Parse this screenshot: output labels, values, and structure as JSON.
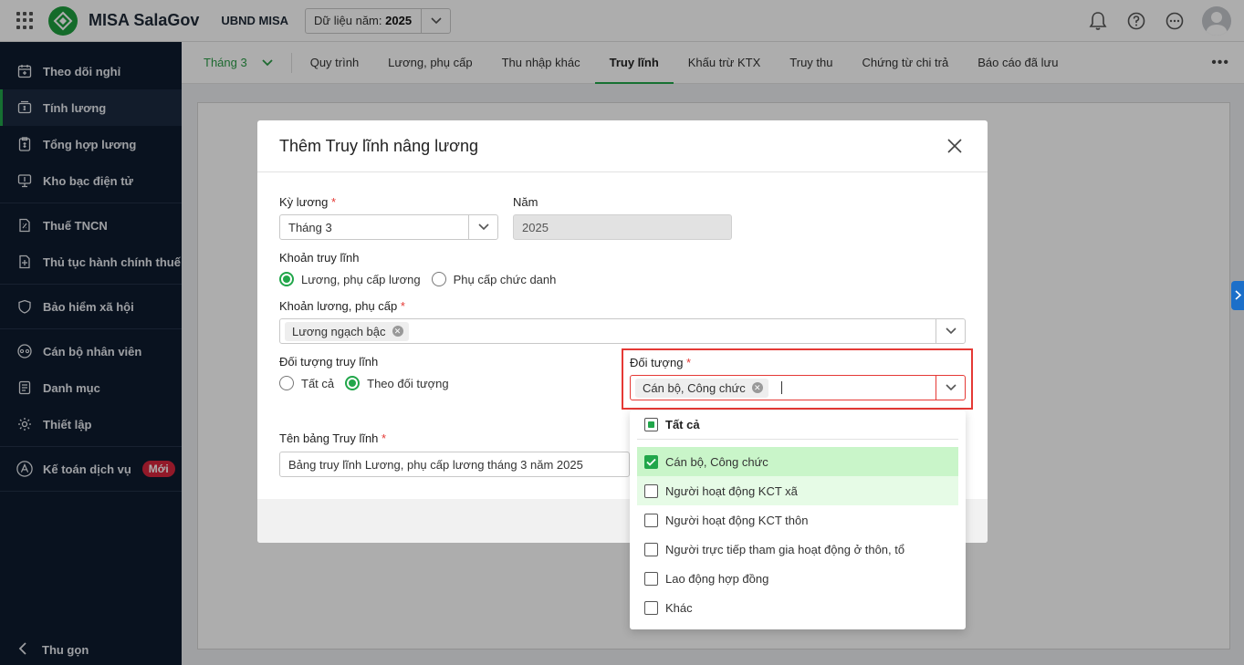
{
  "header": {
    "brand": "MISA SalaGov",
    "org": "UBND MISA",
    "year_prefix": "Dữ liệu năm:",
    "year_value": "2025"
  },
  "sidebar": {
    "items": [
      {
        "label": "Theo dõi nghỉ",
        "icon": "calendar-icon"
      },
      {
        "label": "Tính lương",
        "icon": "salary-calc-icon"
      },
      {
        "label": "Tổng hợp lương",
        "icon": "summary-icon"
      },
      {
        "label": "Kho bạc điện tử",
        "icon": "treasury-icon"
      },
      {
        "label": "Thuế TNCN",
        "icon": "tax-icon"
      },
      {
        "label": "Thủ tục hành chính thuế",
        "icon": "tax-procedure-icon"
      },
      {
        "label": "Bảo hiểm xã hội",
        "icon": "insurance-icon"
      },
      {
        "label": "Cán bộ nhân viên",
        "icon": "staff-icon"
      },
      {
        "label": "Danh mục",
        "icon": "catalog-icon"
      },
      {
        "label": "Thiết lập",
        "icon": "settings-icon"
      },
      {
        "label": "Kế toán dịch vụ",
        "icon": "accounting-icon"
      }
    ],
    "new_badge": "Mới",
    "collapse": "Thu gọn"
  },
  "tabs": {
    "month": "Tháng 3",
    "items": [
      "Quy trình",
      "Lương, phụ cấp",
      "Thu nhập khác",
      "Truy lĩnh",
      "Khấu trừ KTX",
      "Truy thu",
      "Chứng từ chi trả",
      "Báo cáo đã lưu"
    ],
    "active": "Truy lĩnh"
  },
  "modal": {
    "title": "Thêm Truy lĩnh nâng lương",
    "ky_luong_label": "Kỳ lương",
    "ky_luong_value": "Tháng 3",
    "nam_label": "Năm",
    "nam_value": "2025",
    "khoan_truy_linh_label": "Khoản truy lĩnh",
    "khoan_option_1": "Lương, phụ cấp lương",
    "khoan_option_2": "Phụ cấp chức danh",
    "khoan_luong_label": "Khoản lương, phụ cấp",
    "khoan_luong_tag": "Lương ngạch bậc",
    "doi_tuong_truy_linh_label": "Đối tượng truy lĩnh",
    "dt_option_1": "Tất cả",
    "dt_option_2": "Theo đối tượng",
    "doi_tuong_label": "Đối tượng",
    "doi_tuong_tag": "Cán bộ, Công chức",
    "ten_bang_label": "Tên bảng Truy lĩnh",
    "ten_bang_value": "Bảng truy lĩnh Lương, phụ cấp lương tháng 3 năm 2025",
    "required_mark": "*"
  },
  "dropdown": {
    "all_label": "Tất cả",
    "options": [
      {
        "label": "Cán bộ, Công chức",
        "checked": true
      },
      {
        "label": "Người hoạt động KCT xã",
        "checked": false
      },
      {
        "label": "Người hoạt động KCT thôn",
        "checked": false
      },
      {
        "label": "Người trực tiếp tham gia hoạt động ở thôn, tổ",
        "checked": false
      },
      {
        "label": "Lao động hợp đồng",
        "checked": false
      },
      {
        "label": "Khác",
        "checked": false
      }
    ]
  },
  "colors": {
    "accent": "#21a64a",
    "sidebar_bg": "#0e1b2e",
    "highlight_border": "#e53935",
    "selected_option_bg": "#c9f5c9"
  }
}
